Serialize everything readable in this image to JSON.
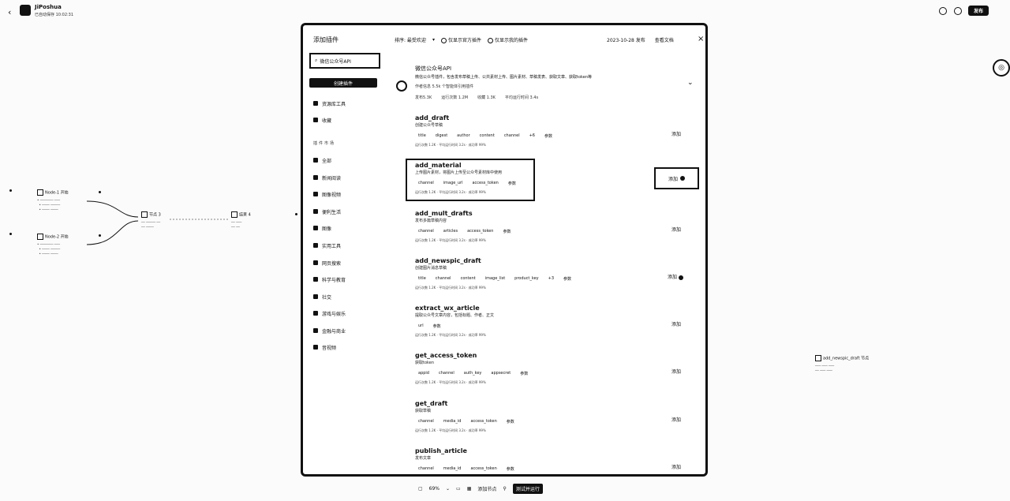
{
  "app": {
    "name": "JiPoshua",
    "subtitle": "已自动保存 10:02:31",
    "back_icon": "chevron-left-icon",
    "publish_label": "发布"
  },
  "canvas": {
    "nodes": [
      {
        "label": "Node-1 开始"
      },
      {
        "label": "Node-2 开始"
      },
      {
        "label": "节点 3"
      },
      {
        "label": "结束 4"
      }
    ],
    "right_node": {
      "label": "add_newspic_draft 节点"
    }
  },
  "bottom_toolbar": {
    "zoom": "69%",
    "add_node_label": "添加节点",
    "run_label": "测试并运行"
  },
  "modal": {
    "title": "添加插件",
    "close_icon": "close-icon",
    "search_label": "微信公众号API",
    "create_label": "创建插件",
    "nav_top": [
      {
        "label": "资源库工具",
        "icon": "library-icon"
      },
      {
        "label": "收藏",
        "icon": "star-icon"
      }
    ],
    "nav_heading": "插件市场",
    "nav_categories": [
      {
        "label": "全部",
        "icon": "grid-icon"
      },
      {
        "label": "新闻阅读",
        "icon": "news-icon"
      },
      {
        "label": "图像视频",
        "icon": "image-icon"
      },
      {
        "label": "便利生活",
        "icon": "life-icon"
      },
      {
        "label": "图像",
        "icon": "picture-icon"
      },
      {
        "label": "实用工具",
        "icon": "tool-icon"
      },
      {
        "label": "网页搜索",
        "icon": "web-icon"
      },
      {
        "label": "科学与教育",
        "icon": "science-icon"
      },
      {
        "label": "社交",
        "icon": "social-icon"
      },
      {
        "label": "游戏与娱乐",
        "icon": "game-icon"
      },
      {
        "label": "金融与商业",
        "icon": "finance-icon"
      },
      {
        "label": "音视频",
        "icon": "audio-icon"
      }
    ],
    "filters": {
      "sort": "排序: 最受欢迎",
      "official_only": "仅显示官方插件",
      "favorites_only": "仅显示我的插件"
    },
    "top_links": [
      "2023-10-28 发布",
      "查看文档"
    ],
    "plugin": {
      "name": "微信公众号API",
      "description": "微信公众号插件，包含发布草稿上传、公共素材上传、图片素材、草稿发表、获取文章、获取token等",
      "meta": "作者信息  5.5k 个智能体引用插件",
      "stats": [
        "发布5.3K",
        "运行次数 1.2M",
        "收藏 1.3K",
        "平均运行时间 3.4s"
      ]
    },
    "tools": [
      {
        "name": "add_draft",
        "desc": "创建公众号草稿",
        "params": [
          "title",
          "digest",
          "author",
          "content",
          "channel",
          "+6",
          "参数"
        ],
        "add": "添加"
      },
      {
        "name": "add_material",
        "desc": "上传图片素材，将图片上传至公众号素材库中使用",
        "params": [
          "channel",
          "image_url",
          "access_token",
          "参数"
        ],
        "add": "添加"
      },
      {
        "name": "add_mult_drafts",
        "desc": "发布多篇草稿内容",
        "params": [
          "channel",
          "articles",
          "access_token",
          "参数"
        ],
        "add": "添加"
      },
      {
        "name": "add_newspic_draft",
        "desc": "创建图片消息草稿",
        "params": [
          "title",
          "channel",
          "content",
          "image_list",
          "product_key",
          "+3",
          "参数"
        ],
        "add": "添加"
      },
      {
        "name": "extract_wx_article",
        "desc": "提取公众号文章内容，包括标题、作者、正文",
        "params": [
          "url",
          "参数"
        ],
        "add": "添加"
      },
      {
        "name": "get_access_token",
        "desc": "获取token",
        "params": [
          "appid",
          "channel",
          "auth_key",
          "appsecret",
          "参数"
        ],
        "add": "添加"
      },
      {
        "name": "get_draft",
        "desc": "获取草稿",
        "params": [
          "channel",
          "media_id",
          "access_token",
          "参数"
        ],
        "add": "添加"
      },
      {
        "name": "publish_article",
        "desc": "发布文章",
        "params": [
          "channel",
          "media_id",
          "access_token",
          "参数"
        ],
        "add": "添加"
      }
    ],
    "tool_stats": "运行次数 1.2K · 平均运行时间 3.2s · 成功率 99%"
  }
}
